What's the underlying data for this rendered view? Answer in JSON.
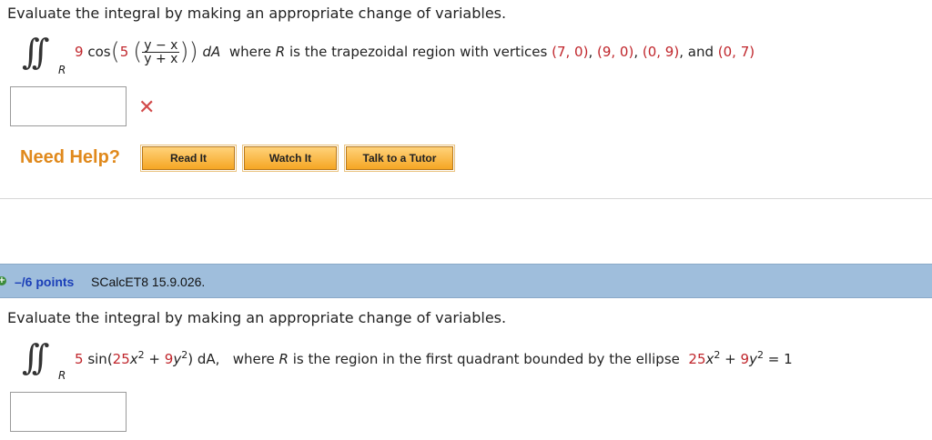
{
  "q1": {
    "prompt": "Evaluate the integral by making an appropriate change of variables.",
    "integral": {
      "subscript": "R",
      "coef": "9",
      "func": "cos",
      "inner_coef": "5",
      "frac_num": "y − x",
      "frac_den": "y + x",
      "differential": "dA",
      "where_text": "where",
      "R_label": "R",
      "region_text": "is the trapezoidal region with vertices",
      "v1": "(7, 0)",
      "v2": "(9, 0)",
      "v3": "(0, 9)",
      "and_text": "and",
      "v4": "(0, 7)"
    },
    "answer_value": "",
    "status": "✕"
  },
  "help": {
    "label": "Need Help?",
    "buttons": [
      "Read It",
      "Watch It",
      "Talk to a Tutor"
    ]
  },
  "q2": {
    "points": "–/6 points",
    "id": "SCalcET8 15.9.026.",
    "prompt": "Evaluate the integral by making an appropriate change of variables.",
    "integral": {
      "subscript": "R",
      "coef": "5",
      "func": "sin(",
      "t1": "25",
      "x2": "x",
      "plus": " + ",
      "t2": "9",
      "y2": "y",
      "tail": ") dA,",
      "where_text": "where",
      "R_label": "R",
      "region_text": "is the region in the first quadrant bounded by the ellipse",
      "e1": "25",
      "e2": "9",
      "rhs": "= 1"
    },
    "answer_value": ""
  },
  "colors": {
    "accent_red": "#c0262c",
    "help_orange": "#e0891c",
    "header_blue": "#9fbedc",
    "points_blue": "#1b3fb8"
  }
}
